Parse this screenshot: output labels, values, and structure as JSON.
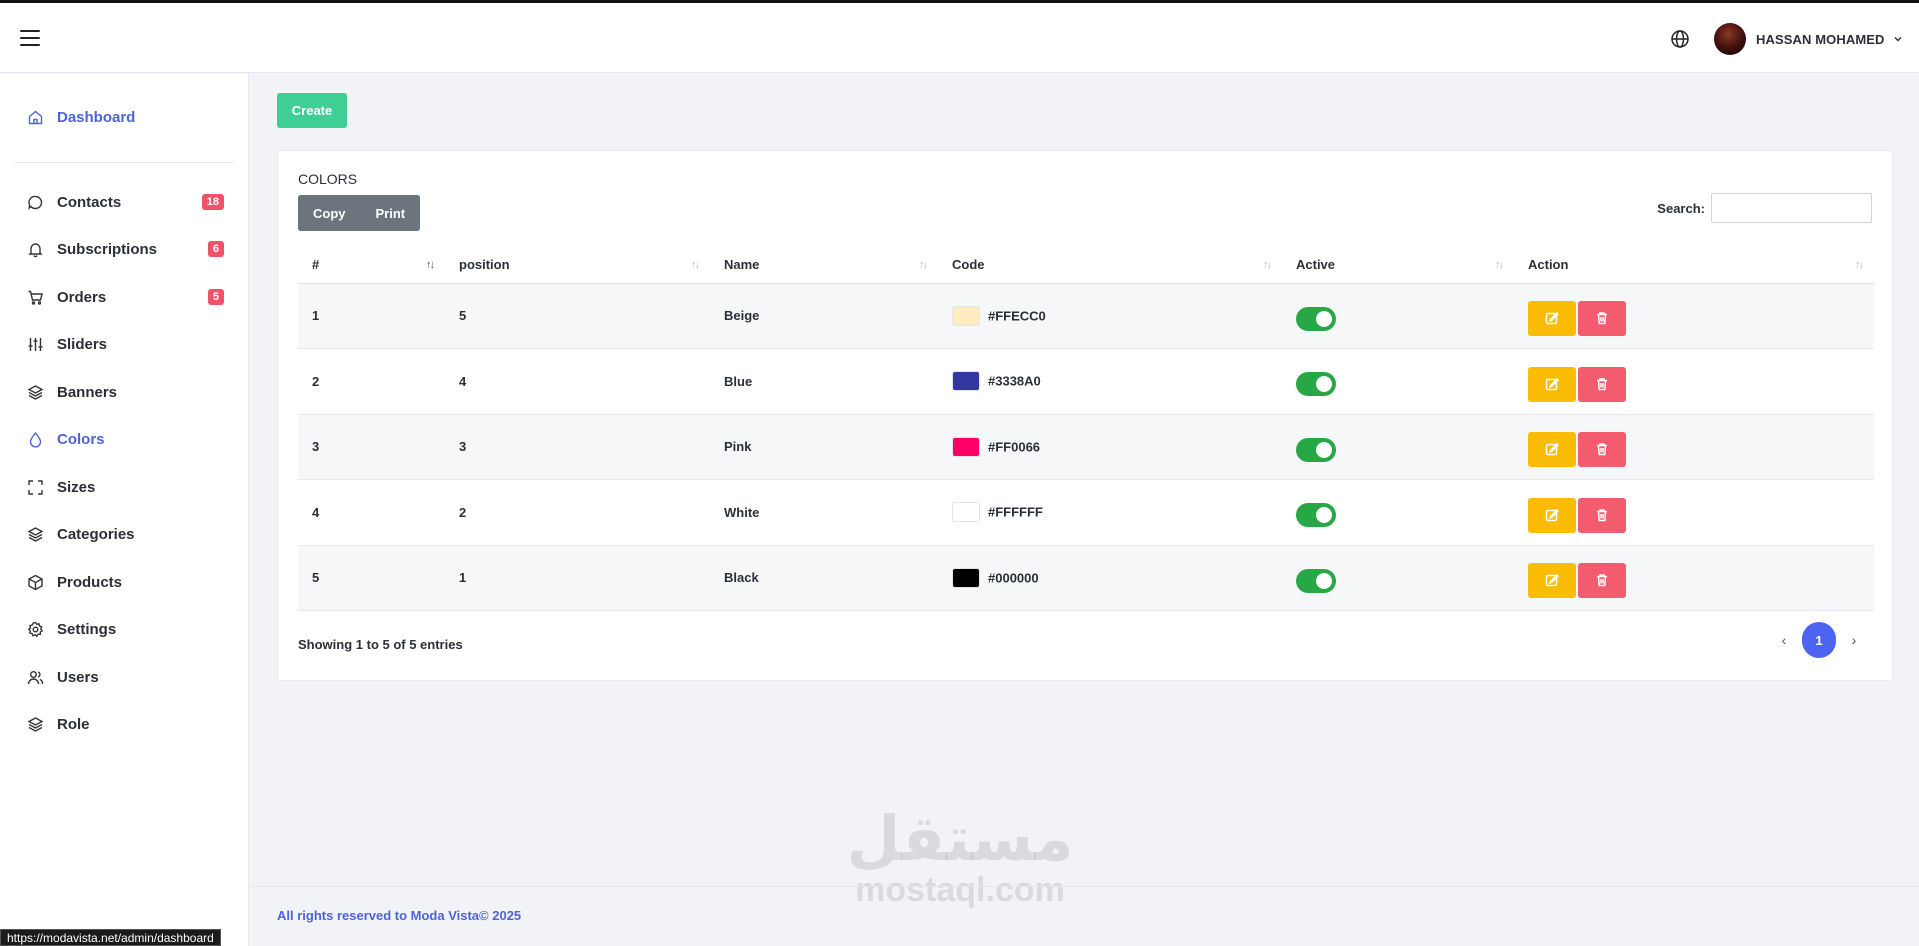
{
  "header": {
    "user_name": "HASSAN MOHAMED"
  },
  "sidebar": {
    "items": [
      {
        "label": "Dashboard",
        "icon": "home-icon",
        "active": true
      },
      {
        "label": "Contacts",
        "icon": "chat-icon",
        "badge": "18"
      },
      {
        "label": "Subscriptions",
        "icon": "bell-icon",
        "badge": "6"
      },
      {
        "label": "Orders",
        "icon": "cart-icon",
        "badge": "5"
      },
      {
        "label": "Sliders",
        "icon": "sliders-icon"
      },
      {
        "label": "Banners",
        "icon": "layers-icon"
      },
      {
        "label": "Colors",
        "icon": "droplet-icon",
        "active": true
      },
      {
        "label": "Sizes",
        "icon": "frame-icon"
      },
      {
        "label": "Categories",
        "icon": "layers-icon"
      },
      {
        "label": "Products",
        "icon": "box-icon"
      },
      {
        "label": "Settings",
        "icon": "gear-icon"
      },
      {
        "label": "Users",
        "icon": "users-icon"
      },
      {
        "label": "Role",
        "icon": "layers-icon"
      }
    ],
    "status_url": "https://modavista.net/admin/dashboard"
  },
  "main": {
    "create_label": "Create",
    "card_title": "COLORS",
    "copy_label": "Copy",
    "print_label": "Print",
    "search_label": "Search:",
    "columns": [
      "#",
      "position",
      "Name",
      "Code",
      "Active",
      "Action"
    ],
    "rows": [
      {
        "num": "1",
        "position": "5",
        "name": "Beige",
        "code": "#FFECC0",
        "swatch": "#FFECC0"
      },
      {
        "num": "2",
        "position": "4",
        "name": "Blue",
        "code": "#3338A0",
        "swatch": "#3338A0"
      },
      {
        "num": "3",
        "position": "3",
        "name": "Pink",
        "code": "#FF0066",
        "swatch": "#FF0066"
      },
      {
        "num": "4",
        "position": "2",
        "name": "White",
        "code": "#FFFFFF",
        "swatch": "#FFFFFF"
      },
      {
        "num": "5",
        "position": "1",
        "name": "Black",
        "code": "#000000",
        "swatch": "#000000"
      }
    ],
    "info": "Showing 1 to 5 of 5 entries",
    "page": "1"
  },
  "footer": {
    "text": "All rights reserved to Moda Vista© 2025"
  },
  "watermark": {
    "arabic": "مستقل",
    "latin": "mostaql.com"
  },
  "colors": {
    "accent": "#4d64d6",
    "create": "#3fcf94",
    "toggle_on": "#28a745",
    "edit": "#fbbc05",
    "delete": "#f35b6f",
    "badge": "#f0526a"
  }
}
